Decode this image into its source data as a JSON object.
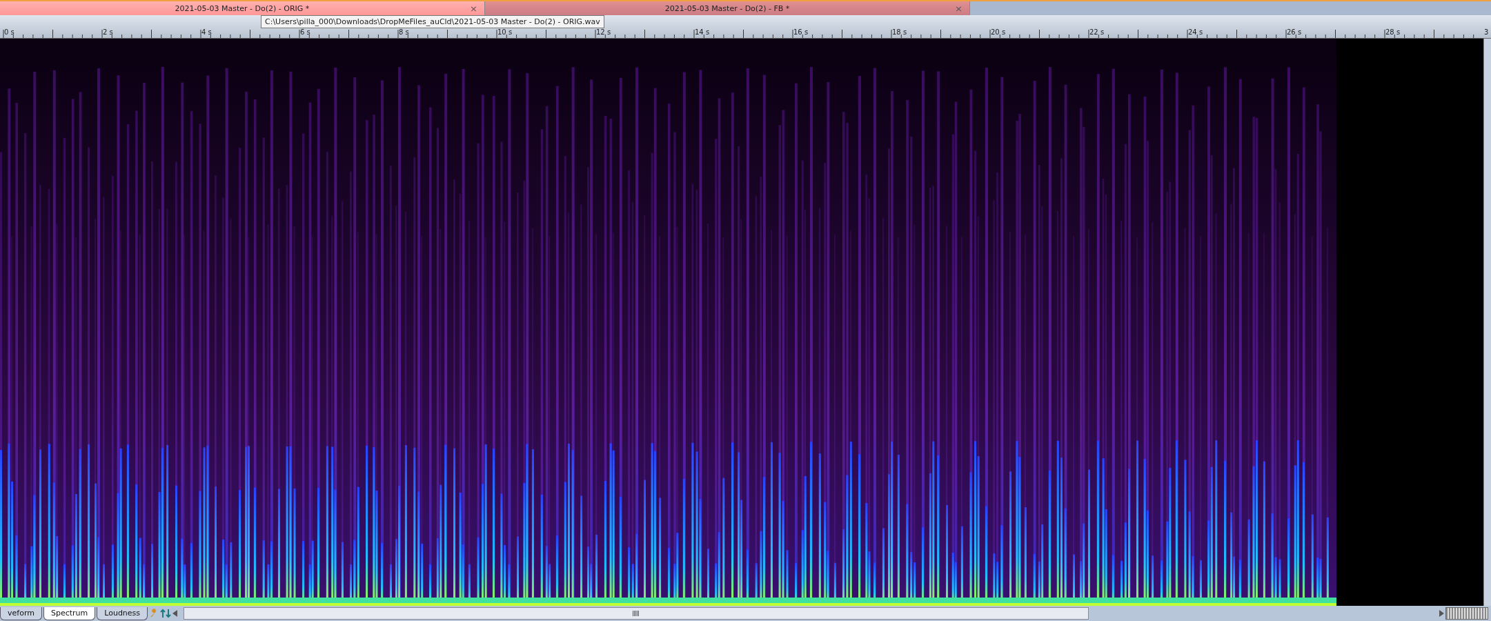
{
  "tabs": [
    {
      "label": "2021-05-03 Master - Do(2) - ORIG *",
      "close": "×",
      "selected": true
    },
    {
      "label": "2021-05-03 Master - Do(2) - FB *",
      "close": "×",
      "selected": false
    }
  ],
  "tooltip": "C:\\Users\\pilla_000\\Downloads\\DropMeFiles_auCld\\2021-05-03 Master - Do(2) - ORIG.wav",
  "ruler": {
    "labels": [
      "0 s",
      "2 s",
      "4 s",
      "6 s",
      "8 s",
      "10 s",
      "12 s",
      "14 s",
      "16 s",
      "18 s",
      "20 s",
      "22 s",
      "24 s",
      "26 s",
      "28 s",
      "3"
    ]
  },
  "view_tabs": [
    {
      "label": "veform",
      "selected": false
    },
    {
      "label": "Spectrum",
      "selected": true
    },
    {
      "label": "Loudness",
      "selected": false
    }
  ]
}
